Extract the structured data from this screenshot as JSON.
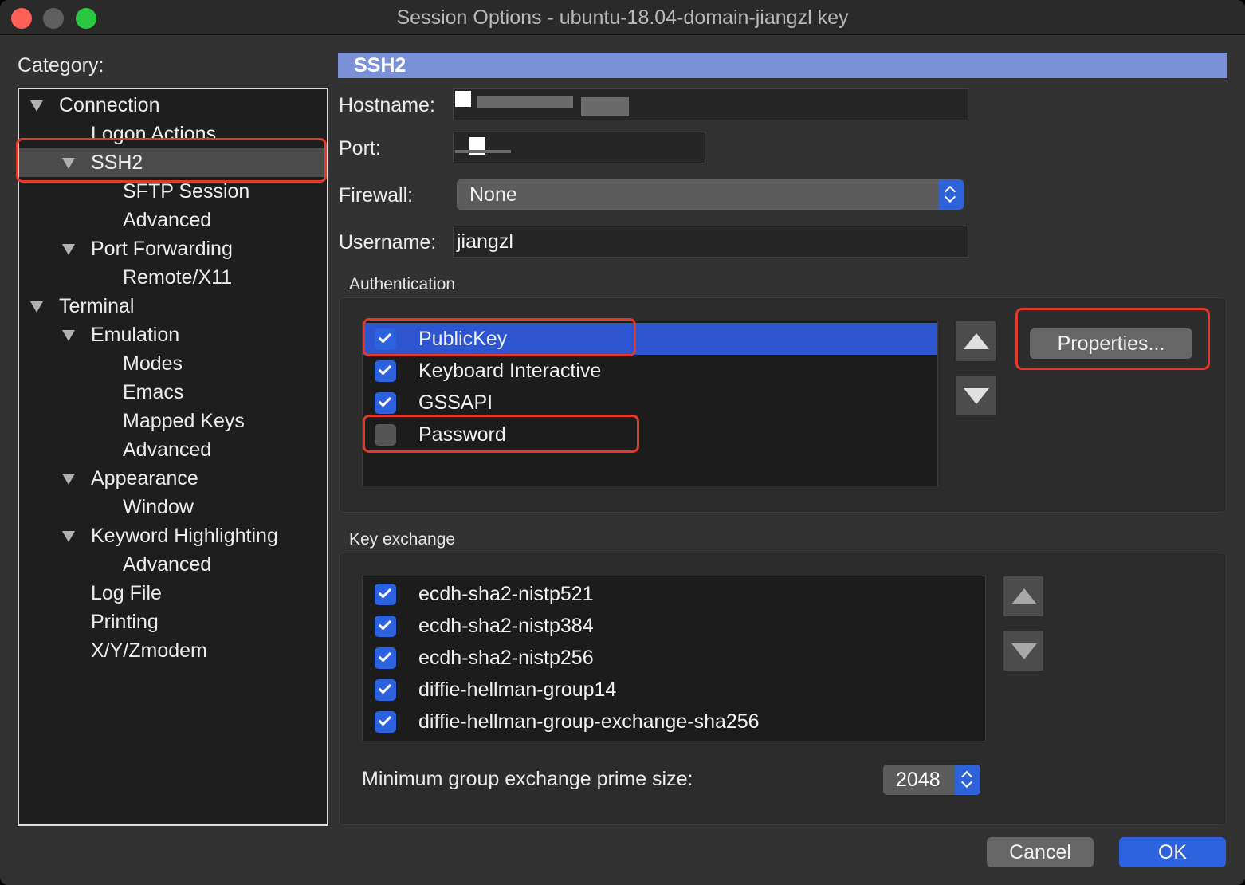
{
  "window": {
    "title": "Session Options - ubuntu-18.04-domain-jiangzl  key"
  },
  "category": {
    "label": "Category:",
    "items": [
      {
        "label": "Connection",
        "level": 0,
        "expanded": true
      },
      {
        "label": "Logon Actions",
        "level": 1
      },
      {
        "label": "SSH2",
        "level": 1,
        "expanded": true,
        "selected": true
      },
      {
        "label": "SFTP Session",
        "level": 2
      },
      {
        "label": "Advanced",
        "level": 2
      },
      {
        "label": "Port Forwarding",
        "level": 1,
        "expanded": true
      },
      {
        "label": "Remote/X11",
        "level": 2
      },
      {
        "label": "Terminal",
        "level": 0,
        "expanded": true
      },
      {
        "label": "Emulation",
        "level": 1,
        "expanded": true
      },
      {
        "label": "Modes",
        "level": 2
      },
      {
        "label": "Emacs",
        "level": 2
      },
      {
        "label": "Mapped Keys",
        "level": 2
      },
      {
        "label": "Advanced",
        "level": 2
      },
      {
        "label": "Appearance",
        "level": 1,
        "expanded": true
      },
      {
        "label": "Window",
        "level": 2
      },
      {
        "label": "Keyword Highlighting",
        "level": 1,
        "expanded": true
      },
      {
        "label": "Advanced",
        "level": 2
      },
      {
        "label": "Log File",
        "level": 1
      },
      {
        "label": "Printing",
        "level": 1
      },
      {
        "label": "X/Y/Zmodem",
        "level": 1
      }
    ]
  },
  "panel": {
    "header": "SSH2",
    "hostname_label": "Hostname:",
    "port_label": "Port:",
    "firewall_label": "Firewall:",
    "firewall_value": "None",
    "username_label": "Username:",
    "username_value": "jiangzl"
  },
  "authentication": {
    "title": "Authentication",
    "methods": [
      {
        "label": "PublicKey",
        "checked": true,
        "selected": true
      },
      {
        "label": "Keyboard Interactive",
        "checked": true
      },
      {
        "label": "GSSAPI",
        "checked": true
      },
      {
        "label": "Password",
        "checked": false
      }
    ],
    "properties_label": "Properties..."
  },
  "key_exchange": {
    "title": "Key exchange",
    "algorithms": [
      {
        "label": "ecdh-sha2-nistp521",
        "checked": true
      },
      {
        "label": "ecdh-sha2-nistp384",
        "checked": true
      },
      {
        "label": "ecdh-sha2-nistp256",
        "checked": true
      },
      {
        "label": "diffie-hellman-group14",
        "checked": true
      },
      {
        "label": "diffie-hellman-group-exchange-sha256",
        "checked": true
      }
    ],
    "prime_label": "Minimum group exchange prime size:",
    "prime_value": "2048"
  },
  "footer": {
    "cancel_label": "Cancel",
    "ok_label": "OK"
  },
  "colors": {
    "accent": "#2c62dd",
    "section_header": "#7b90d6",
    "highlight": "#e3392b"
  }
}
